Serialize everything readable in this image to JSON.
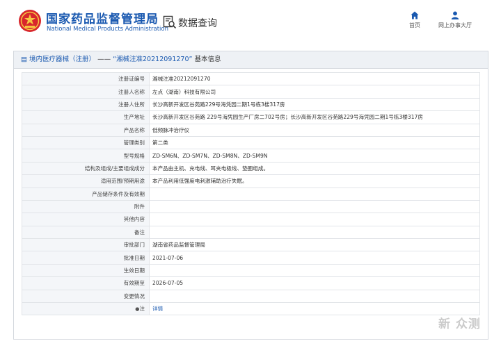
{
  "header": {
    "brand_cn": "国家药品监督管理局",
    "brand_en": "National Medical Products Administration",
    "search_label": "数据查询",
    "nav": [
      {
        "label": "首页",
        "icon": "home-icon"
      },
      {
        "label": "网上办事大厅",
        "icon": "user-icon"
      }
    ]
  },
  "panel": {
    "crumb_prefix": "境内医疗器械（注册）",
    "crumb_sep": "——",
    "crumb_emph": "“湘械注准20212091270”",
    "crumb_suffix": "基本信息"
  },
  "rows": [
    {
      "key": "注册证编号",
      "value": "湘械注准20212091270"
    },
    {
      "key": "注册人名称",
      "value": "左点（湖南）科技有限公司"
    },
    {
      "key": "注册人住所",
      "value": "长沙高新开发区谷苑路229号海凭园二期1号栋3楼317房"
    },
    {
      "key": "生产地址",
      "value": "长沙高新开发区谷苑路 229号海凭园生产厂房二702号房；长沙高新开发区谷苑路229号海凭园二期1号栋3楼317房"
    },
    {
      "key": "产品名称",
      "value": "低频脉冲治疗仪"
    },
    {
      "key": "管理类别",
      "value": "第二类"
    },
    {
      "key": "型号规格",
      "value": "ZD-SM6N、ZD-SM7N、ZD-SM8N、ZD-SM9N"
    },
    {
      "key": "结构及组成/主要组成成分",
      "value": "本产品由主机、充电线、耳夹电极线、垫圈组成。"
    },
    {
      "key": "适用范围/预期用途",
      "value": "本产品利用低强度电刺激辅助治疗失眠。"
    },
    {
      "key": "产品储存条件及有效期",
      "value": ""
    },
    {
      "key": "附件",
      "value": ""
    },
    {
      "key": "其他内容",
      "value": ""
    },
    {
      "key": "备注",
      "value": ""
    },
    {
      "key": "审批部门",
      "value": "湖南省药品监督管理局"
    },
    {
      "key": "批准日期",
      "value": "2021-07-06"
    },
    {
      "key": "生效日期",
      "value": ""
    },
    {
      "key": "有效期至",
      "value": "2026-07-05"
    },
    {
      "key": "变更情况",
      "value": ""
    }
  ],
  "note_row": {
    "key": "注",
    "link": "详情"
  },
  "watermark": "新 众测",
  "colors": {
    "brand": "#1a59b0",
    "header_bg": "#eef1f5",
    "key_bg": "#f4f6f9",
    "border": "#d4d8de"
  }
}
